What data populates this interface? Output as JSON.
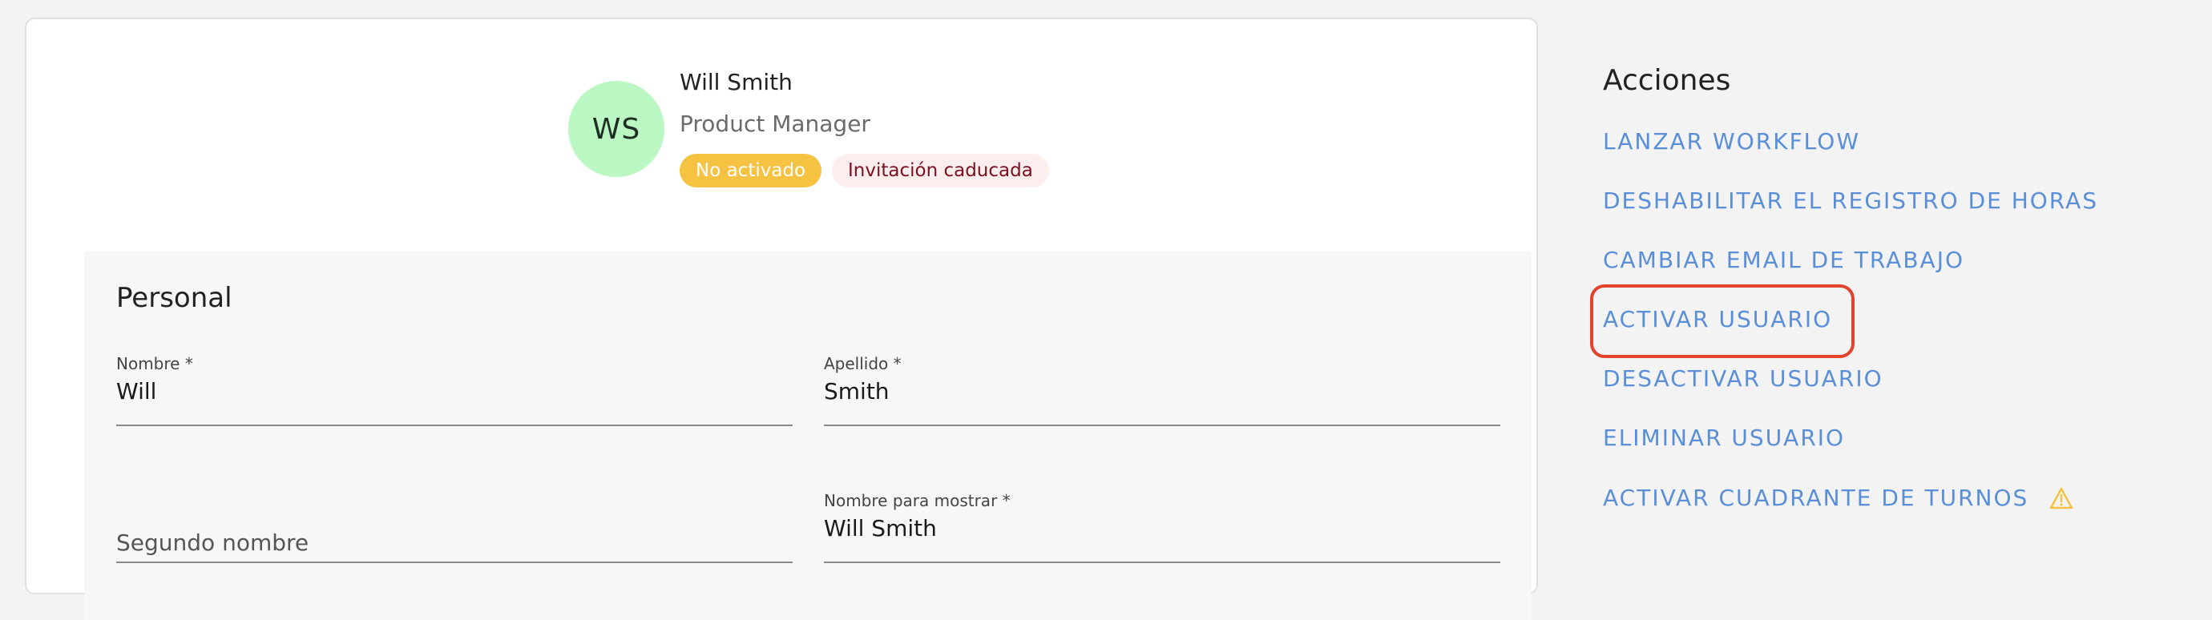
{
  "profile": {
    "initials": "WS",
    "name": "Will Smith",
    "role": "Product Manager",
    "badges": [
      {
        "label": "No activado",
        "color": "#f5c242"
      },
      {
        "label": "Invitación caducada",
        "color": "#fdeeee"
      }
    ]
  },
  "personal": {
    "title": "Personal",
    "fields": {
      "first_name": {
        "label": "Nombre *",
        "value": "Will"
      },
      "last_name": {
        "label": "Apellido *",
        "value": "Smith"
      },
      "middle_name": {
        "placeholder": "Segundo nombre"
      },
      "display_name": {
        "label": "Nombre para mostrar *",
        "value": "Will Smith"
      }
    }
  },
  "actions": {
    "title": "Acciones",
    "items": [
      {
        "label": "LANZAR WORKFLOW"
      },
      {
        "label": "DESHABILITAR EL REGISTRO DE HORAS"
      },
      {
        "label": "CAMBIAR EMAIL DE TRABAJO"
      },
      {
        "label": "ACTIVAR USUARIO"
      },
      {
        "label": "DESACTIVAR USUARIO"
      },
      {
        "label": "ELIMINAR USUARIO"
      },
      {
        "label": "ACTIVAR CUADRANTE DE TURNOS",
        "icon": "warning-icon"
      }
    ],
    "highlighted_index": 3
  },
  "colors": {
    "link": "#5a8fd8",
    "avatar_bg": "#baf7c2",
    "highlight": "#e0442d",
    "warning": "#f5c242"
  }
}
